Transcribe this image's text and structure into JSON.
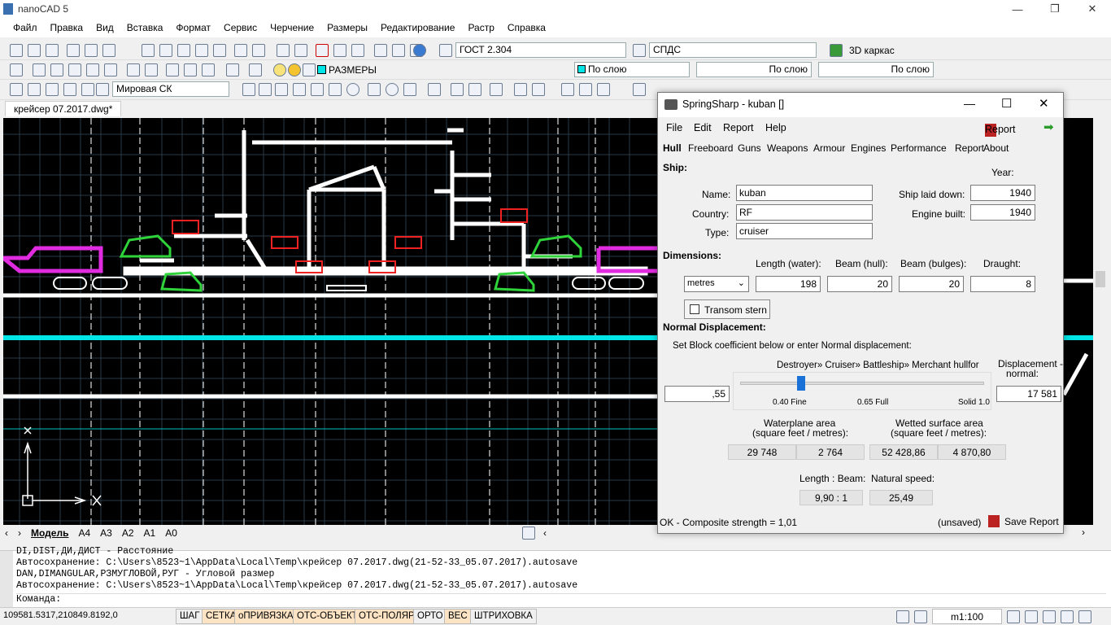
{
  "app": {
    "title": "nanoCAD 5"
  },
  "menu": [
    "Файл",
    "Правка",
    "Вид",
    "Вставка",
    "Формат",
    "Сервис",
    "Черчение",
    "Размеры",
    "Редактирование",
    "Растр",
    "Справка"
  ],
  "toolbar1": {
    "style_field": "ГОСТ 2.304",
    "dim_field": "СПДС",
    "visual_style": "3D каркас"
  },
  "toolbar2": {
    "layer_field": "РАЗМЕРЫ",
    "color_field": "По слою",
    "linetype_field": "По слою",
    "lineweight_field": "По слою"
  },
  "toolbar3": {
    "ucs_field": "Мировая СК"
  },
  "document": {
    "tab": "крейсер 07.2017.dwg*"
  },
  "layout_tabs": [
    "Модель",
    "A4",
    "A3",
    "A2",
    "A1",
    "A0"
  ],
  "command": {
    "lines": [
      "DI,DIST,ДИ,ДИСТ - Расстояние",
      "Автосохранение: C:\\Users\\8523~1\\AppData\\Local\\Temp\\крейсер 07.2017.dwg(21-52-33_05.07.2017).autosave",
      "DAN,DIMANGULAR,РЗМУГЛОВОЙ,РУГ - Угловой размер",
      "Автосохранение: C:\\Users\\8523~1\\AppData\\Local\\Temp\\крейсер 07.2017.dwg(21-52-33_05.07.2017).autosave"
    ],
    "prompt": "Команда:",
    "side_label": "Кома..."
  },
  "status": {
    "coords": "109581.5317,210849.8192,0",
    "buttons": [
      "ШАГ",
      "СЕТКА",
      "оПРИВЯЗКА",
      "ОТС-ОБЪЕКТ",
      "ОТС-ПОЛЯР",
      "ОРТО",
      "ВЕС",
      "ШТРИХОВКА"
    ],
    "scale": "m1:100"
  },
  "dialog": {
    "title": "SpringSharp - kuban []",
    "menu": [
      "File",
      "Edit",
      "Report",
      "Help"
    ],
    "report_button": "Report",
    "tabs": [
      "Hull",
      "Freeboard",
      "Guns",
      "Weapons",
      "Armour",
      "Engines",
      "Performance",
      "Report",
      "About"
    ],
    "ship_section": "Ship:",
    "name_label": "Name:",
    "name_value": "kuban",
    "country_label": "Country:",
    "country_value": "RF",
    "type_label": "Type:",
    "type_value": "cruiser",
    "year_label": "Year:",
    "laid_down_label": "Ship laid down:",
    "laid_down_value": "1940",
    "engine_built_label": "Engine built:",
    "engine_built_value": "1940",
    "dimensions_section": "Dimensions:",
    "units_value": "metres",
    "length_label": "Length (water):",
    "length_value": "198",
    "beam_hull_label": "Beam (hull):",
    "beam_hull_value": "20",
    "beam_bulges_label": "Beam (bulges):",
    "beam_bulges_value": "20",
    "draught_label": "Draught:",
    "draught_value": "8",
    "transom_label": "Transom stern",
    "normal_disp_section": "Normal Displacement:",
    "block_instruction": "Set Block coefficient below or enter Normal displacement:",
    "hull_scale": "Destroyer» Cruiser» Battleship» Merchant hullfor",
    "block_coeff_value": ",55",
    "slider_position": 0.55,
    "slider_labels": [
      "0.40 Fine",
      "0.65 Full",
      "Solid 1.0"
    ],
    "disp_label_1": "Displacement -",
    "disp_label_2": "normal:",
    "disp_value": "17 581",
    "waterplane_label_1": "Waterplane area",
    "waterplane_label_2": "(square feet / metres):",
    "waterplane_ft": "29 748",
    "waterplane_m": "2 764",
    "wetted_label_1": "Wetted surface area",
    "wetted_label_2": "(square feet / metres):",
    "wetted_ft": "52 428,86",
    "wetted_m": "4 870,80",
    "length_beam_label": "Length : Beam:",
    "length_beam_value": "9,90 : 1",
    "natural_speed_label": "Natural speed:",
    "natural_speed_value": "25,49",
    "status_left": "OK - Composite strength = 1,01",
    "unsaved": "(unsaved)",
    "save_report": "Save Report"
  }
}
